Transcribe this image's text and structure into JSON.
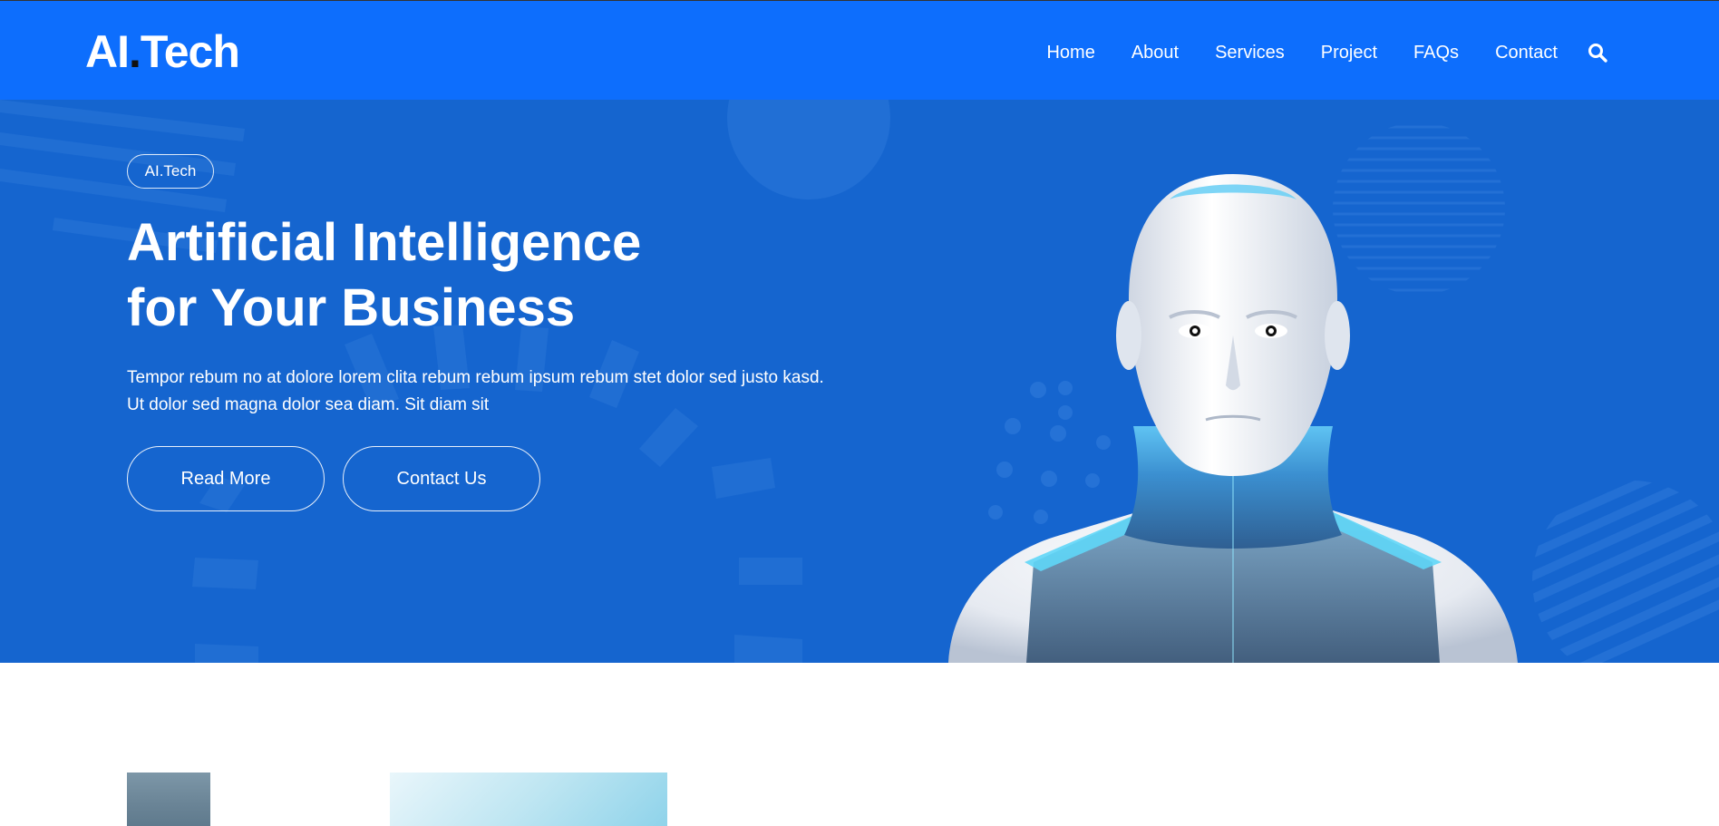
{
  "brand": {
    "name_part1": "AI",
    "dot": ".",
    "name_part2": "Tech"
  },
  "nav": {
    "items": [
      {
        "label": "Home"
      },
      {
        "label": "About"
      },
      {
        "label": "Services"
      },
      {
        "label": "Project"
      },
      {
        "label": "FAQs"
      },
      {
        "label": "Contact"
      }
    ],
    "search_icon": "search-icon"
  },
  "hero": {
    "badge": "AI.Tech",
    "headline_line1": "Artificial Intelligence",
    "headline_line2": "for Your Business",
    "lead": "Tempor rebum no at dolore lorem clita rebum rebum ipsum rebum stet dolor sed justo kasd. Ut dolor sed magna dolor sea diam. Sit diam sit",
    "read_more": "Read More",
    "contact_us": "Contact Us",
    "image": "robot-illustration"
  },
  "colors": {
    "navbar": "#0d6efd",
    "hero": "#1565cf",
    "text": "#ffffff",
    "robot_skin": "#eef1f6",
    "robot_glass": "#3aa0e8"
  }
}
